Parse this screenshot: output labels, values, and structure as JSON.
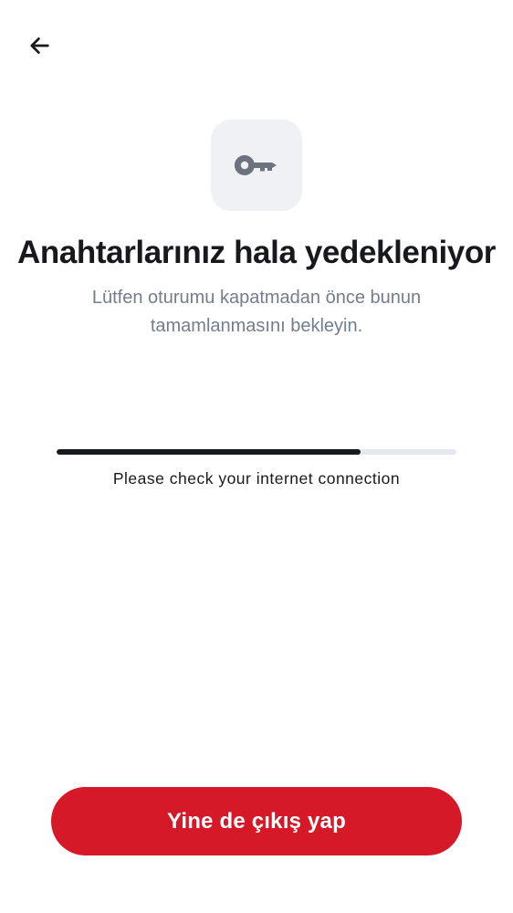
{
  "header": {
    "back_icon": "arrow-left-icon"
  },
  "hero": {
    "icon": "key-icon",
    "title": "Anahtarlarınız hala yedekleniyor",
    "subtitle": "Lütfen oturumu kapatmadan önce bunun tamamlanmasını bekleyin."
  },
  "backup": {
    "progress_fraction": 0.76,
    "status": "Please check your internet connection"
  },
  "footer": {
    "signout_label": "Yine de çıkış yap"
  },
  "colors": {
    "accent": "#d51928",
    "text_primary": "#17191c",
    "text_secondary": "#737d8c",
    "icon_tile": "#eff1f5",
    "progress_track": "#e3e8f0"
  }
}
